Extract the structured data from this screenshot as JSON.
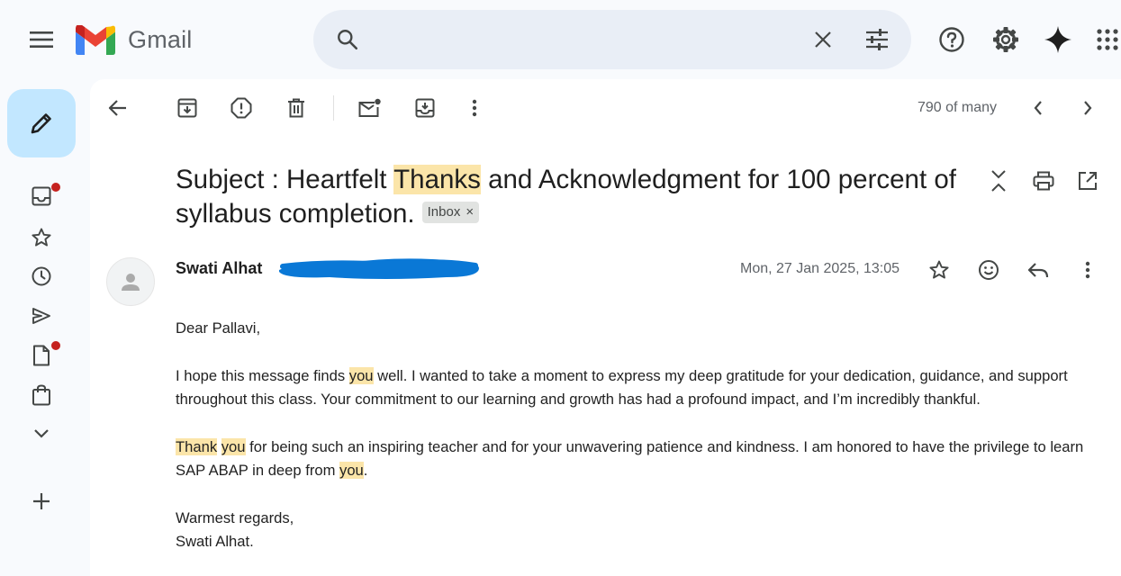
{
  "app": {
    "name": "Gmail"
  },
  "search": {
    "placeholder": ""
  },
  "toolbar": {
    "count": "790 of many"
  },
  "message": {
    "subject": {
      "part1": "Subject : Heartfelt ",
      "highlight": "Thanks",
      "part2": " and Acknowledgment for 100 percent of syllabus completion."
    },
    "label": "Inbox",
    "label_remove": "×",
    "sender": "Swati Alhat",
    "date": "Mon, 27 Jan 2025, 13:05",
    "body": {
      "greeting": "Dear Pallavi,",
      "p1_a": "I hope this message finds ",
      "p1_hl": "you",
      "p1_b": " well. I wanted to take a moment to express my deep gratitude for your dedication, guidance, and support throughout this class. Your commitment to our learning and growth has had a profound impact, and I’m incredibly thankful.",
      "p2_hl1": "Thank",
      "p2_sp": " ",
      "p2_hl2": "you",
      "p2_a": " for being such an inspiring teacher and for your unwavering patience and kindness.  I am honored to have  the privilege to learn SAP ABAP in deep from ",
      "p2_hl3": "you",
      "p2_end": ".",
      "closing": "Warmest regards,",
      "signature": "Swati Alhat."
    }
  },
  "colors": {
    "compose_bg": "#c2e7ff",
    "search_bg": "#e9eef6",
    "highlight": "#fbe5a9",
    "badge_dot": "#c5221f",
    "redaction": "#0a78d6"
  }
}
